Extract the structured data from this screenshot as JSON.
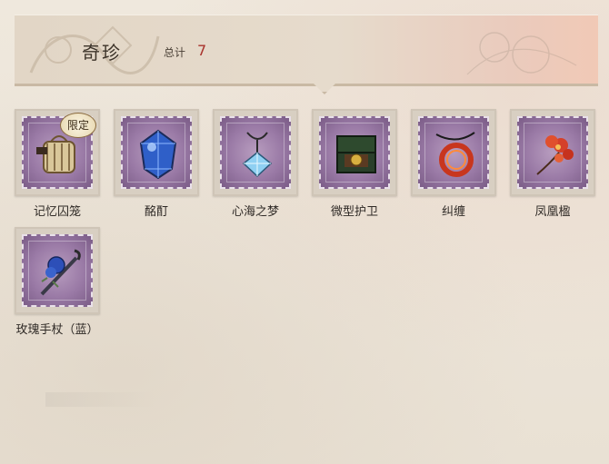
{
  "header": {
    "title": "奇珍",
    "total_label": "总计",
    "total_count": "7"
  },
  "items": [
    {
      "name": "记忆囚笼",
      "badge": "限定",
      "icon": "memory-cage-icon"
    },
    {
      "name": "酩酊",
      "icon": "blue-gem-icon"
    },
    {
      "name": "心海之梦",
      "icon": "crystal-pendant-icon"
    },
    {
      "name": "微型护卫",
      "icon": "jewel-box-icon"
    },
    {
      "name": "纠缠",
      "icon": "red-coil-icon"
    },
    {
      "name": "凤凰楹",
      "icon": "red-flower-icon"
    },
    {
      "name": "玫瑰手杖（蓝）",
      "icon": "rose-cane-icon"
    }
  ],
  "colors": {
    "stamp": "#9a7aa6",
    "accent_count": "#a8322c"
  }
}
